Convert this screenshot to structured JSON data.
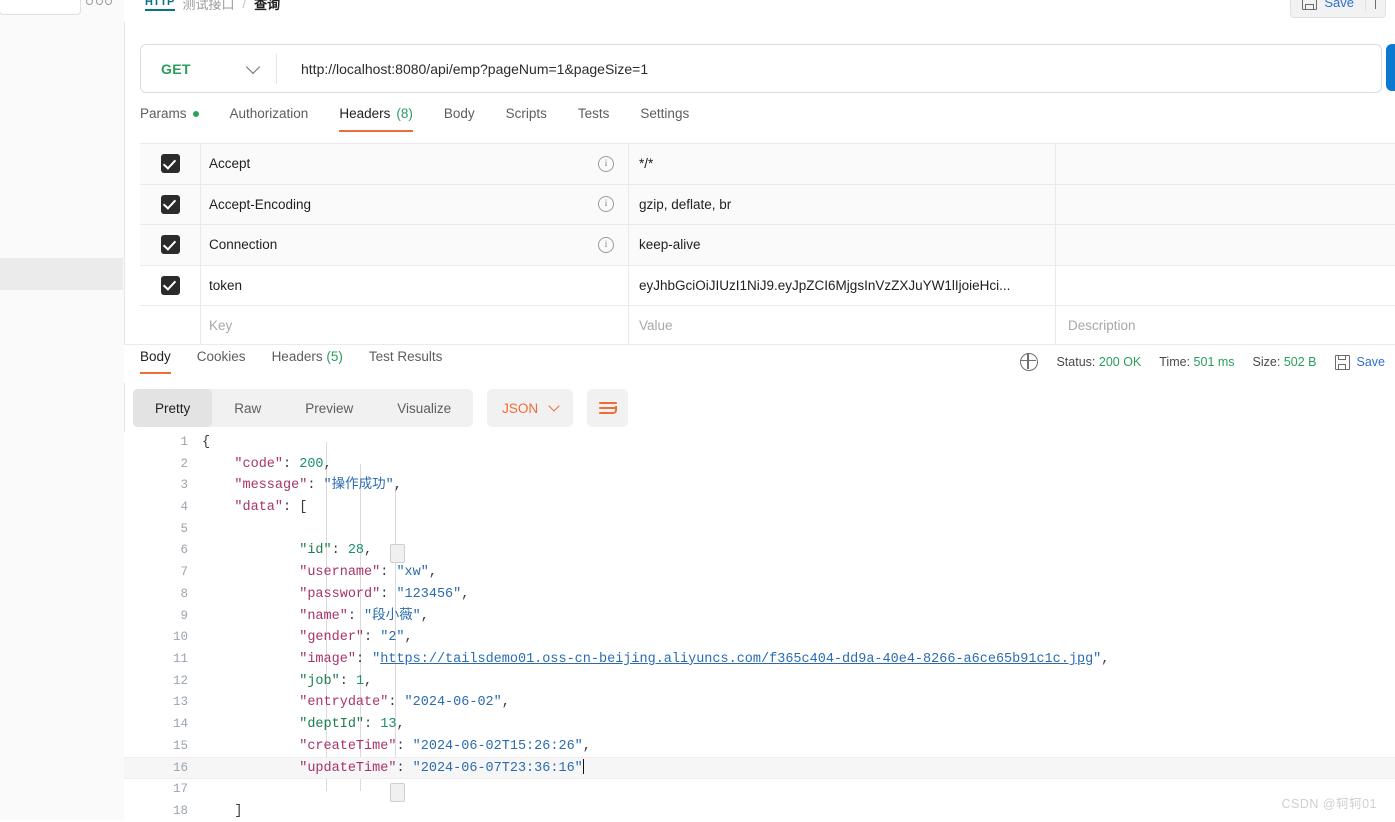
{
  "sidebar": {
    "search_placeholder": "",
    "more_label": "•••"
  },
  "breadcrumb": {
    "protocol": "HTTP",
    "folder": "测试接口",
    "separator": "/",
    "current": "查询"
  },
  "topbar": {
    "save_label": "Save",
    "save_caret": "⌄"
  },
  "url_bar": {
    "method": "GET",
    "url": "http://localhost:8080/api/emp?pageNum=1&pageSize=1"
  },
  "request_tabs": [
    {
      "label": "Params",
      "dot": true,
      "count": "",
      "active": false
    },
    {
      "label": "Authorization",
      "dot": false,
      "count": "",
      "active": false
    },
    {
      "label": "Headers",
      "dot": false,
      "count": "(8)",
      "active": true
    },
    {
      "label": "Body",
      "dot": false,
      "count": "",
      "active": false
    },
    {
      "label": "Scripts",
      "dot": false,
      "count": "",
      "active": false
    },
    {
      "label": "Tests",
      "dot": false,
      "count": "",
      "active": false
    },
    {
      "label": "Settings",
      "dot": false,
      "count": "",
      "active": false
    }
  ],
  "headers_table": {
    "columns": [
      "Key",
      "Value",
      "Description"
    ],
    "placeholder_row": {
      "key": "Key",
      "value": "Value",
      "description": "Description"
    },
    "rows": [
      {
        "checked": true,
        "key": "Accept",
        "has_info": true,
        "value": "*/*",
        "description": ""
      },
      {
        "checked": true,
        "key": "Accept-Encoding",
        "has_info": true,
        "value": "gzip, deflate, br",
        "description": ""
      },
      {
        "checked": true,
        "key": "Connection",
        "has_info": true,
        "value": "keep-alive",
        "description": ""
      },
      {
        "checked": true,
        "key": "token",
        "has_info": false,
        "value": "eyJhbGciOiJIUzI1NiJ9.eyJpZCI6MjgsInVzZXJuYW1lIjoieHci...",
        "description": ""
      }
    ]
  },
  "response_tabs": [
    {
      "label": "Body",
      "count": "",
      "active": true
    },
    {
      "label": "Cookies",
      "count": "",
      "active": false
    },
    {
      "label": "Headers",
      "count": "(5)",
      "active": false
    },
    {
      "label": "Test Results",
      "count": "",
      "active": false
    }
  ],
  "response_meta": {
    "status_label": "Status:",
    "status_value": "200 OK",
    "time_label": "Time:",
    "time_value": "501 ms",
    "size_label": "Size:",
    "size_value": "502 B",
    "save_label": "Save"
  },
  "body_toolbar": {
    "views": [
      {
        "label": "Pretty",
        "active": true
      },
      {
        "label": "Raw",
        "active": false
      },
      {
        "label": "Preview",
        "active": false
      },
      {
        "label": "Visualize",
        "active": false
      }
    ],
    "format": "JSON",
    "format_caret": "⌄",
    "wrap_icon": "wrap-lines-icon"
  },
  "json_body": {
    "lines": [
      {
        "n": "1",
        "html": "<span class=\"pn\">{</span>"
      },
      {
        "n": "2",
        "html": "    <span class=\"k\">\"code\"</span><span class=\"pn\">: </span><span class=\"num\">200</span><span class=\"pn\">,</span>"
      },
      {
        "n": "3",
        "html": "    <span class=\"k\">\"message\"</span><span class=\"pn\">: </span><span class=\"str\">\"操作成功\"</span><span class=\"pn\">,</span>"
      },
      {
        "n": "4",
        "html": "    <span class=\"k\">\"data\"</span><span class=\"pn\">: [</span>"
      },
      {
        "n": "5",
        "html": ""
      },
      {
        "n": "6",
        "html": "            <span class=\"k2\">\"id\"</span><span class=\"pn\">: </span><span class=\"num\">28</span><span class=\"pn\">,</span>"
      },
      {
        "n": "7",
        "html": "            <span class=\"k\">\"username\"</span><span class=\"pn\">: </span><span class=\"str\">\"xw\"</span><span class=\"pn\">,</span>"
      },
      {
        "n": "8",
        "html": "            <span class=\"k\">\"password\"</span><span class=\"pn\">: </span><span class=\"str\">\"123456\"</span><span class=\"pn\">,</span>"
      },
      {
        "n": "9",
        "html": "            <span class=\"k\">\"name\"</span><span class=\"pn\">: </span><span class=\"str\">\"段小薇\"</span><span class=\"pn\">,</span>"
      },
      {
        "n": "10",
        "html": "            <span class=\"k\">\"gender\"</span><span class=\"pn\">: </span><span class=\"str\">\"2\"</span><span class=\"pn\">,</span>"
      },
      {
        "n": "11",
        "html": "            <span class=\"k\">\"image\"</span><span class=\"pn\">: </span><span class=\"str\">\"</span><span class=\"lnk\">https://tailsdemo01.oss-cn-beijing.aliyuncs.com/f365c404-dd9a-40e4-8266-a6ce65b91c1c.jpg</span><span class=\"str\">\"</span><span class=\"pn\">,</span>"
      },
      {
        "n": "12",
        "html": "            <span class=\"k2\">\"job\"</span><span class=\"pn\">: </span><span class=\"num\">1</span><span class=\"pn\">,</span>"
      },
      {
        "n": "13",
        "html": "            <span class=\"k\">\"entrydate\"</span><span class=\"pn\">: </span><span class=\"str\">\"2024-06-02\"</span><span class=\"pn\">,</span>"
      },
      {
        "n": "14",
        "html": "            <span class=\"k2\">\"deptId\"</span><span class=\"pn\">: </span><span class=\"num\">13</span><span class=\"pn\">,</span>"
      },
      {
        "n": "15",
        "html": "            <span class=\"k\">\"createTime\"</span><span class=\"pn\">: </span><span class=\"str\">\"2024-06-02T15:26:26\"</span><span class=\"pn\">,</span>",
        "hl": false
      },
      {
        "n": "16",
        "html": "            <span class=\"k\">\"updateTime\"</span><span class=\"pn\">: </span><span class=\"str\">\"2024-06-07T23:36:16\"</span><span class=\"caret\"></span>",
        "hl": true
      },
      {
        "n": "17",
        "html": ""
      },
      {
        "n": "18",
        "html": "    <span class=\"pn\">]</span>"
      }
    ],
    "raw": {
      "code": 200,
      "message": "操作成功",
      "data": [
        {
          "id": 28,
          "username": "xw",
          "password": "123456",
          "name": "段小薇",
          "gender": "2",
          "image": "https://tailsdemo01.oss-cn-beijing.aliyuncs.com/f365c404-dd9a-40e4-8266-a6ce65b91c1c.jpg",
          "job": 1,
          "entrydate": "2024-06-02",
          "deptId": 13,
          "createTime": "2024-06-02T15:26:26",
          "updateTime": "2024-06-07T23:36:16"
        }
      ]
    }
  },
  "watermark": "CSDN @轲轲01",
  "colors": {
    "accent": "#ef6c37",
    "green": "#2a9d5c",
    "link": "#2b6cb0",
    "send": "#0b79d0"
  }
}
